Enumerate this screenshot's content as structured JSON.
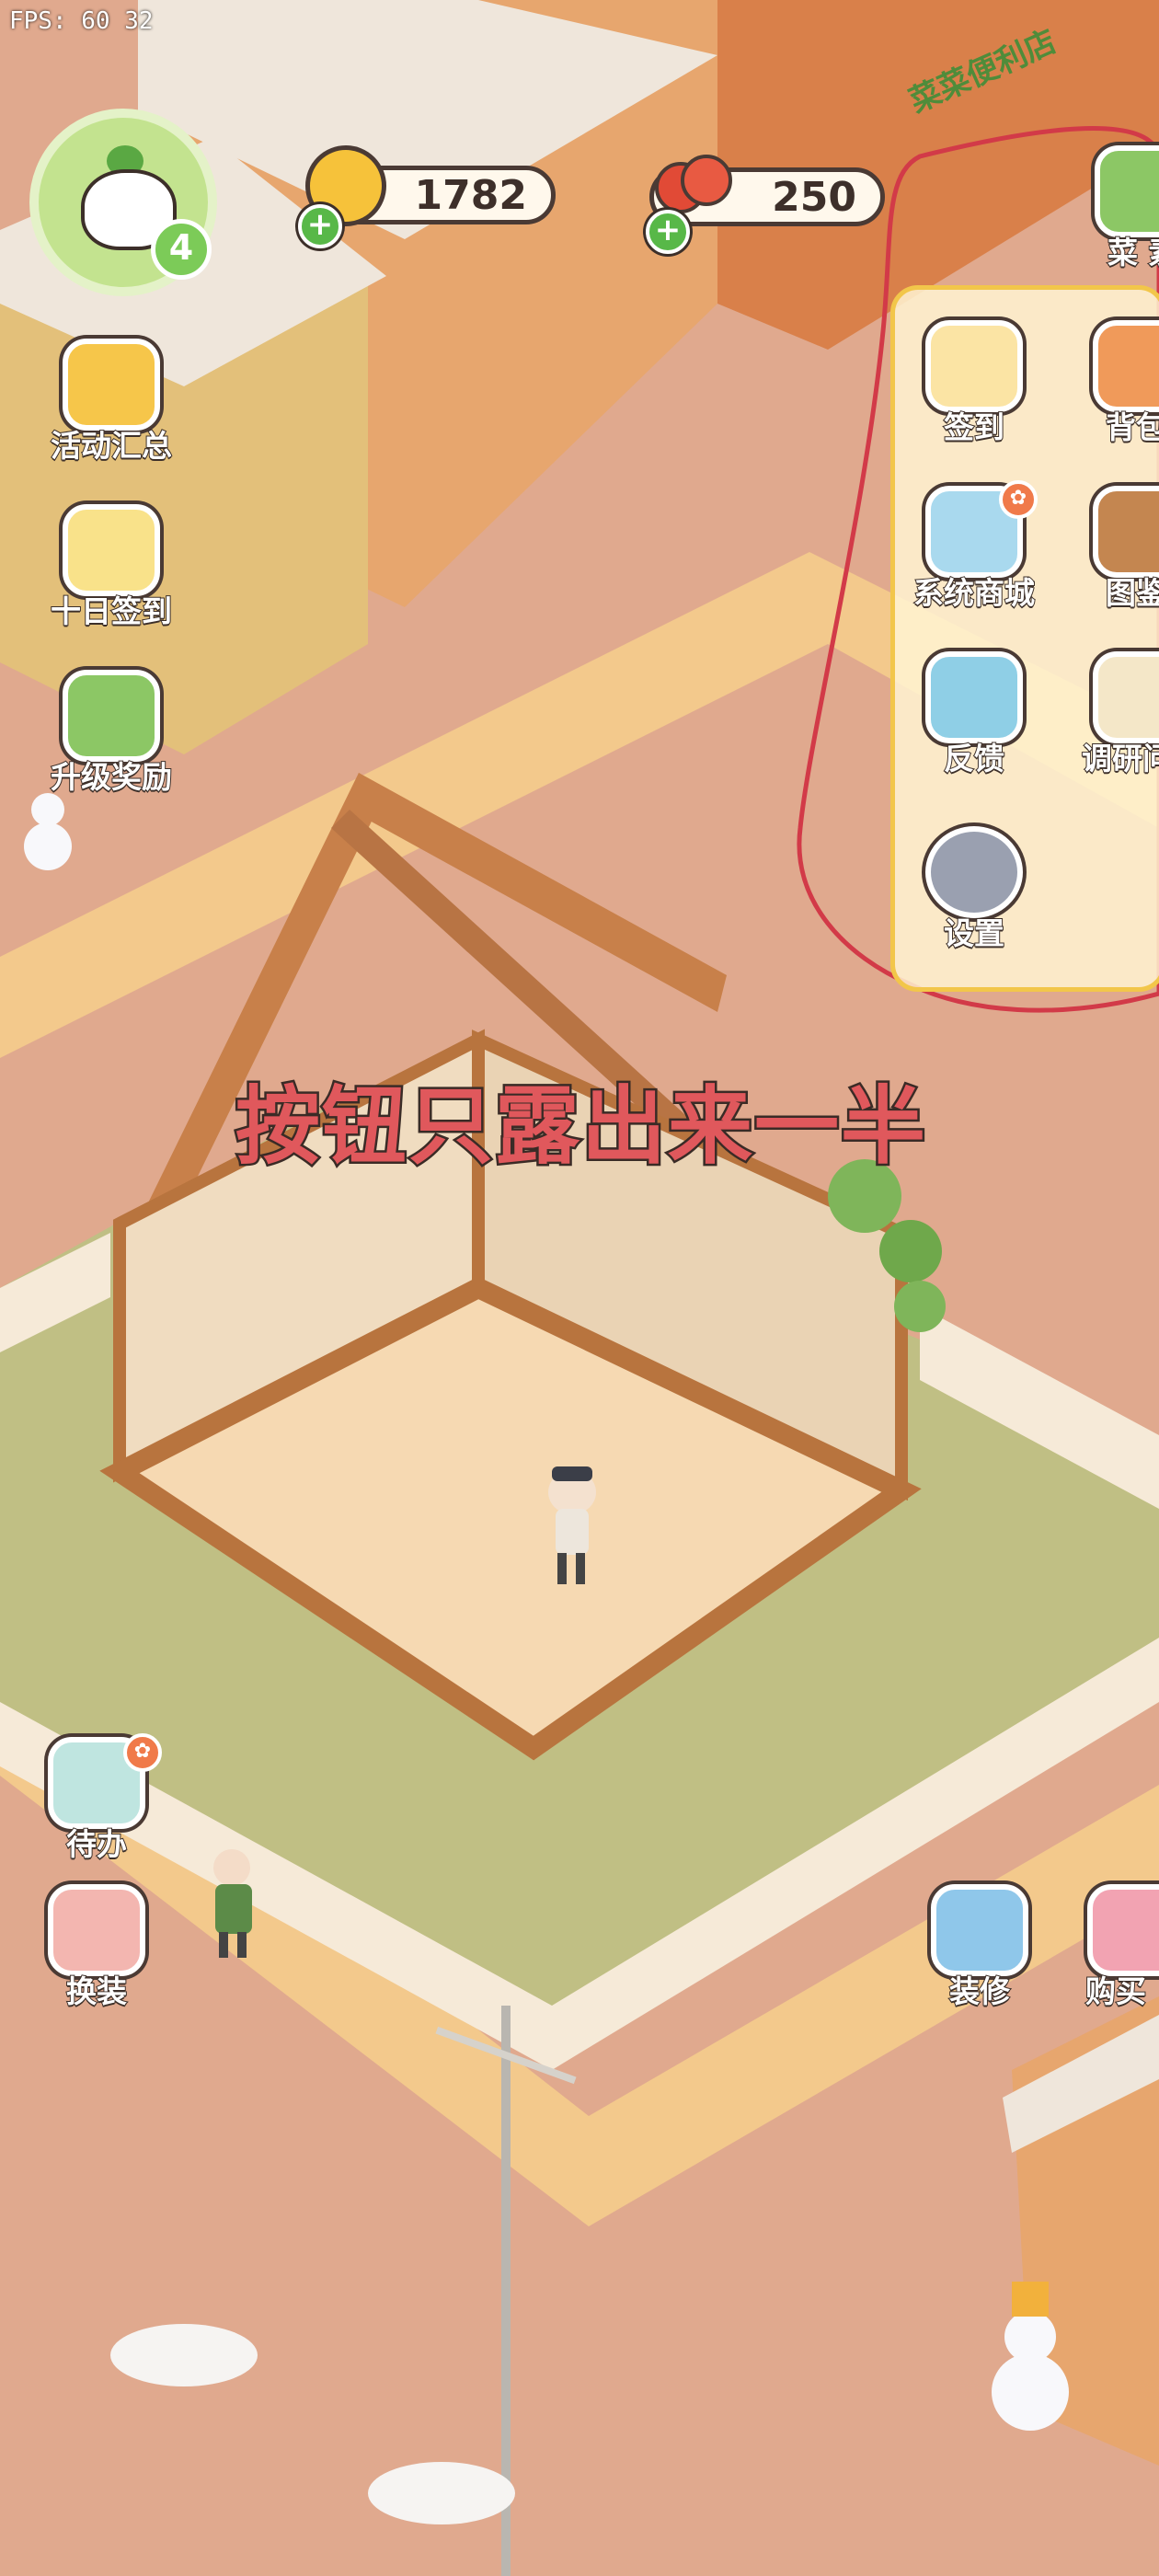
{
  "hud": {
    "fps_text": "FPS: 60 32",
    "player_level": "4",
    "coins": "1782",
    "berries": "250"
  },
  "left_menu": [
    {
      "label": "活动汇总",
      "icon": "crown-icon"
    },
    {
      "label": "十日签到",
      "icon": "gift-calendar-icon"
    },
    {
      "label": "升级奖励",
      "icon": "tree-upgrade-icon"
    }
  ],
  "right_panel": {
    "items": [
      {
        "label": "签到",
        "icon": "calendar-icon"
      },
      {
        "label": "背包",
        "icon": "backpack-icon"
      },
      {
        "label": "系统商城",
        "icon": "shop-icon"
      },
      {
        "label": "图鉴",
        "icon": "book-icon"
      },
      {
        "label": "反馈",
        "icon": "bug-icon"
      },
      {
        "label": "调研问",
        "icon": "survey-icon"
      },
      {
        "label": "设置",
        "icon": "gear-icon"
      }
    ],
    "top_clipped_label": "菜 素"
  },
  "bottom_left": [
    {
      "label": "待办",
      "icon": "todo-list-icon"
    },
    {
      "label": "换装",
      "icon": "dress-up-icon"
    }
  ],
  "bottom_right": [
    {
      "label": "装修",
      "icon": "decorate-icon"
    },
    {
      "label": "购买",
      "icon": "buy-icon"
    }
  ],
  "annotation": "按钮只露出来一半",
  "shop_sign": "菜菜便利店",
  "colors": {
    "annotation_red": "#e0585c",
    "panel_border": "#f2c64a",
    "grass": "#c0bf84",
    "road": "#e0a98e"
  }
}
